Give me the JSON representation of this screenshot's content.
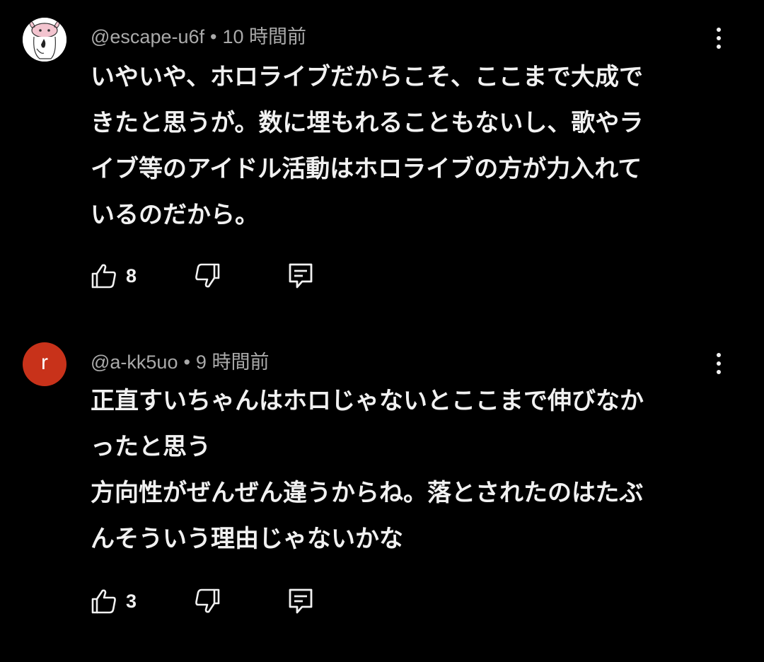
{
  "comments": [
    {
      "author": "@escape-u6f",
      "separator": "•",
      "time": "10 時間前",
      "avatar_icon": "cow-avatar-icon",
      "lines": [
        "いやいや、ホロライブだからこそ、ここまで大成で",
        "きたと思うが。数に埋もれることもないし、歌やラ",
        "イブ等のアイドル活動はホロライブの方が力入れて",
        "いるのだから。"
      ],
      "likes": "8"
    },
    {
      "author": "@a-kk5uo",
      "separator": "•",
      "time": "9 時間前",
      "avatar_letter": "r",
      "avatar_color": "#c8321a",
      "lines": [
        "正直すいちゃんはホロじゃないとここまで伸びなか",
        "ったと思う",
        "方向性がぜんぜん違うからね。落とされたのはたぶ",
        "んそういう理由じゃないかな"
      ],
      "likes": "3"
    }
  ],
  "icons": {
    "like": "thumbs-up-icon",
    "dislike": "thumbs-down-icon",
    "reply": "reply-comment-icon",
    "menu": "more-vert-icon"
  }
}
